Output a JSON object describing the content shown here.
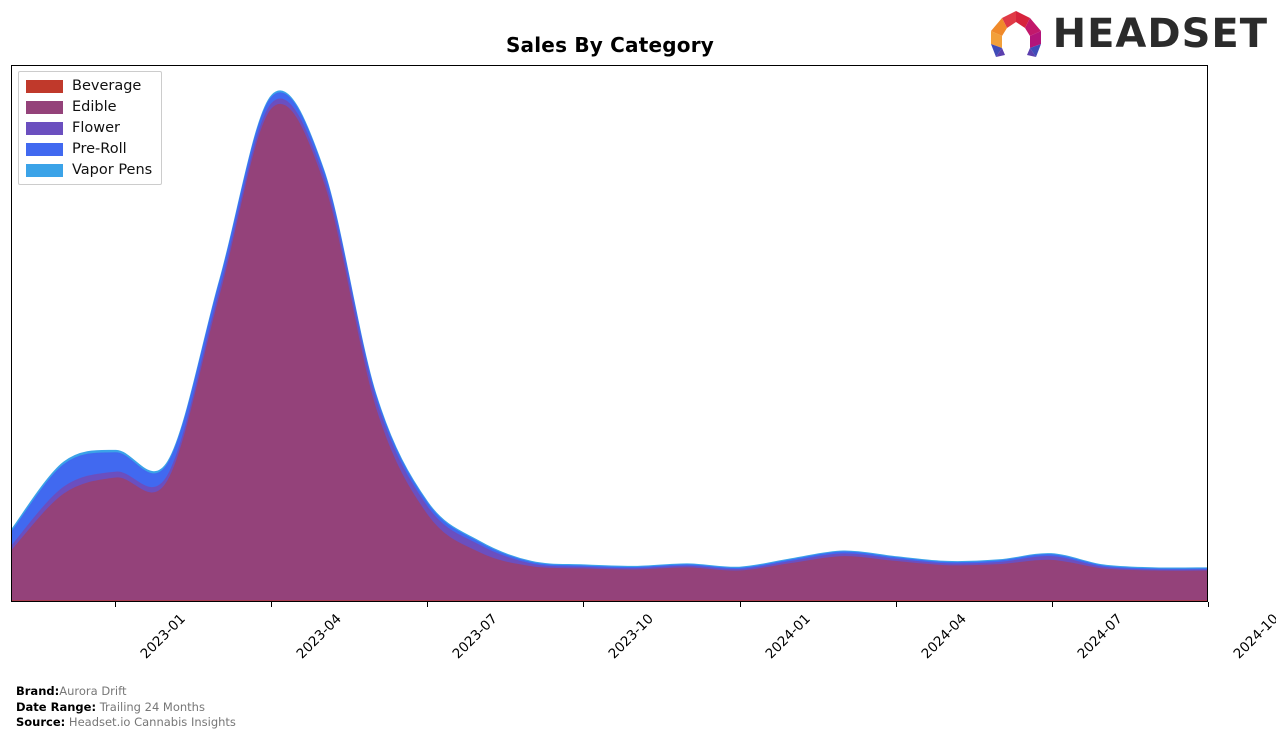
{
  "header": {
    "title": "Sales By Category",
    "logo_text": "HEADSET"
  },
  "footer": {
    "brand_key": "Brand:",
    "brand_value": "Aurora Drift",
    "date_range_key": "Date Range:",
    "date_range_value": "Trailing 24 Months",
    "source_key": "Source:",
    "source_value": "Headset.io Cannabis Insights"
  },
  "legend": {
    "items": [
      {
        "label": "Beverage",
        "color": "#c0392b"
      },
      {
        "label": "Edible",
        "color": "#94427a"
      },
      {
        "label": "Flower",
        "color": "#6b4fbf"
      },
      {
        "label": "Pre-Roll",
        "color": "#4169f0"
      },
      {
        "label": "Vapor Pens",
        "color": "#3ba3e8"
      }
    ]
  },
  "chart_data": {
    "type": "area",
    "stacked": true,
    "title": "Sales By Category",
    "xlabel": "",
    "ylabel": "",
    "grid": false,
    "legend_position": "top-left",
    "axis_ticks": [
      "2023-01",
      "2023-04",
      "2023-07",
      "2023-10",
      "2024-01",
      "2024-04",
      "2024-07",
      "2024-10"
    ],
    "x": [
      "2022-11",
      "2022-12",
      "2023-01",
      "2023-02",
      "2023-03",
      "2023-04",
      "2023-05",
      "2023-06",
      "2023-07",
      "2023-08",
      "2023-09",
      "2023-10",
      "2023-11",
      "2023-12",
      "2024-01",
      "2024-02",
      "2024-03",
      "2024-04",
      "2024-05",
      "2024-06",
      "2024-07",
      "2024-08",
      "2024-09",
      "2024-10"
    ],
    "ylim": [
      0,
      100
    ],
    "series": [
      {
        "name": "Beverage",
        "color": "#c0392b",
        "values": [
          0,
          0,
          0,
          0,
          0,
          0,
          0,
          0,
          0,
          0,
          0,
          0,
          0,
          0,
          0,
          0,
          0,
          0,
          0,
          0,
          0,
          0,
          0,
          0
        ]
      },
      {
        "name": "Edible",
        "color": "#94427a",
        "values": [
          9.5,
          20.0,
          23.0,
          22.5,
          57.0,
          92.0,
          78.0,
          36.0,
          16.0,
          9.0,
          6.4,
          6.0,
          5.8,
          6.2,
          5.6,
          7.0,
          8.3,
          7.4,
          6.6,
          6.8,
          7.6,
          6.0,
          5.6,
          5.6
        ]
      },
      {
        "name": "Flower",
        "color": "#6b4fbf",
        "values": [
          0.9,
          1.3,
          1.1,
          1.0,
          1.2,
          1.0,
          1.2,
          1.6,
          1.5,
          1.4,
          0.5,
          0.3,
          0.25,
          0.3,
          0.3,
          0.4,
          0.5,
          0.4,
          0.35,
          0.4,
          0.7,
          0.3,
          0.2,
          0.2
        ]
      },
      {
        "name": "Pre-Roll",
        "color": "#4169f0",
        "values": [
          2.6,
          4.2,
          3.6,
          2.2,
          1.6,
          1.2,
          1.1,
          0.9,
          0.7,
          0.5,
          0.3,
          0.25,
          0.22,
          0.25,
          0.22,
          0.3,
          0.35,
          0.3,
          0.25,
          0.3,
          0.35,
          0.25,
          0.2,
          0.2
        ]
      },
      {
        "name": "Vapor Pens",
        "color": "#3ba3e8",
        "values": [
          0.5,
          0.5,
          0.45,
          0.4,
          0.35,
          0.35,
          0.3,
          0.3,
          0.3,
          0.25,
          0.2,
          0.2,
          0.2,
          0.2,
          0.2,
          0.2,
          0.2,
          0.2,
          0.2,
          0.2,
          0.2,
          0.2,
          0.2,
          0.2
        ]
      }
    ]
  }
}
